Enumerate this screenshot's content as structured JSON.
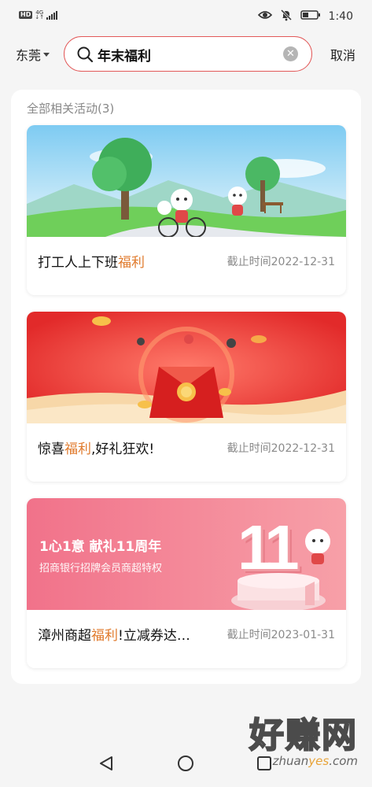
{
  "status": {
    "hd": "HD",
    "net_top": "4G",
    "net_bottom": "↓↑",
    "time": "1:40",
    "icons": [
      "eye-icon",
      "mute-bell-icon",
      "battery-icon"
    ]
  },
  "search": {
    "city": "东莞",
    "query": "年末福利",
    "cancel": "取消"
  },
  "results": {
    "section_title": "全部相关活动(3)",
    "cards": [
      {
        "title_pre": "打工人上下班",
        "title_hl": "福利",
        "title_post": "",
        "deadline": "截止时间2022-12-31"
      },
      {
        "title_pre": "惊喜",
        "title_hl": "福利",
        "title_post": ",好礼狂欢!",
        "deadline": "截止时间2022-12-31"
      },
      {
        "title_pre": "漳州商超",
        "title_hl": "福利",
        "title_post": "!立减券达…",
        "deadline": "截止时间2023-01-31",
        "banner_heading": "1心1意 献礼11周年",
        "banner_sub": "招商银行招牌会员商超特权",
        "banner_number": "11"
      }
    ]
  },
  "watermark": {
    "big": "好赚网",
    "url_pre": "zhuan",
    "url_hl": "yes",
    "url_post": ".com"
  },
  "colors": {
    "accent_red": "#e25858",
    "highlight_orange": "#e07a2c"
  }
}
